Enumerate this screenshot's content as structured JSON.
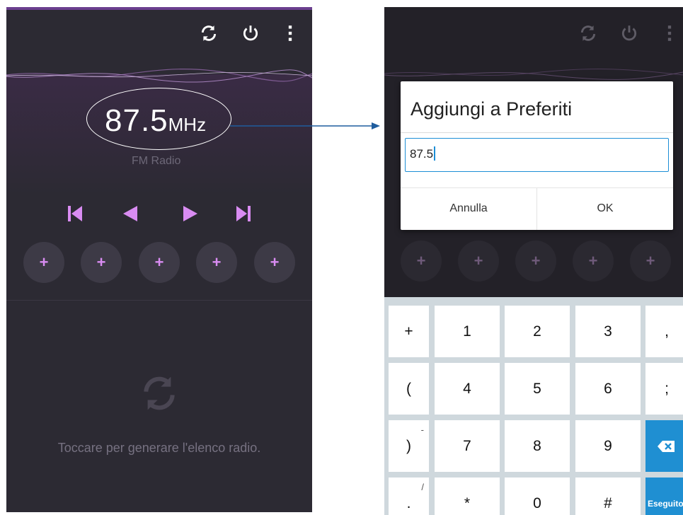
{
  "left_screen": {
    "frequency": "87.5",
    "unit": "MHz",
    "station_label": "FM Radio",
    "presets": [
      "+",
      "+",
      "+",
      "+",
      "+"
    ],
    "hint_text": "Toccare per generare l'elenco radio."
  },
  "right_screen": {
    "dialog": {
      "title": "Aggiungi a Preferiti",
      "input_value": "87.5",
      "cancel_label": "Annulla",
      "ok_label": "OK"
    },
    "presets": [
      "+",
      "+",
      "+",
      "+",
      "+"
    ],
    "keyboard": {
      "rows": [
        [
          "+",
          "1",
          "2",
          "3",
          ","
        ],
        [
          "(",
          "4",
          "5",
          "6",
          ";"
        ],
        [
          ")",
          "7",
          "8",
          "9",
          ""
        ],
        [
          ".",
          "*",
          "0",
          "#",
          "Eseguito"
        ]
      ],
      "sub_hints": {
        "row2": "-",
        "row3": "/"
      }
    }
  },
  "colors": {
    "accent": "#d98cf2",
    "app_bg": "#2c2a33",
    "annotation_arrow": "#1f5d9e",
    "key_blue": "#1f8fd2"
  }
}
